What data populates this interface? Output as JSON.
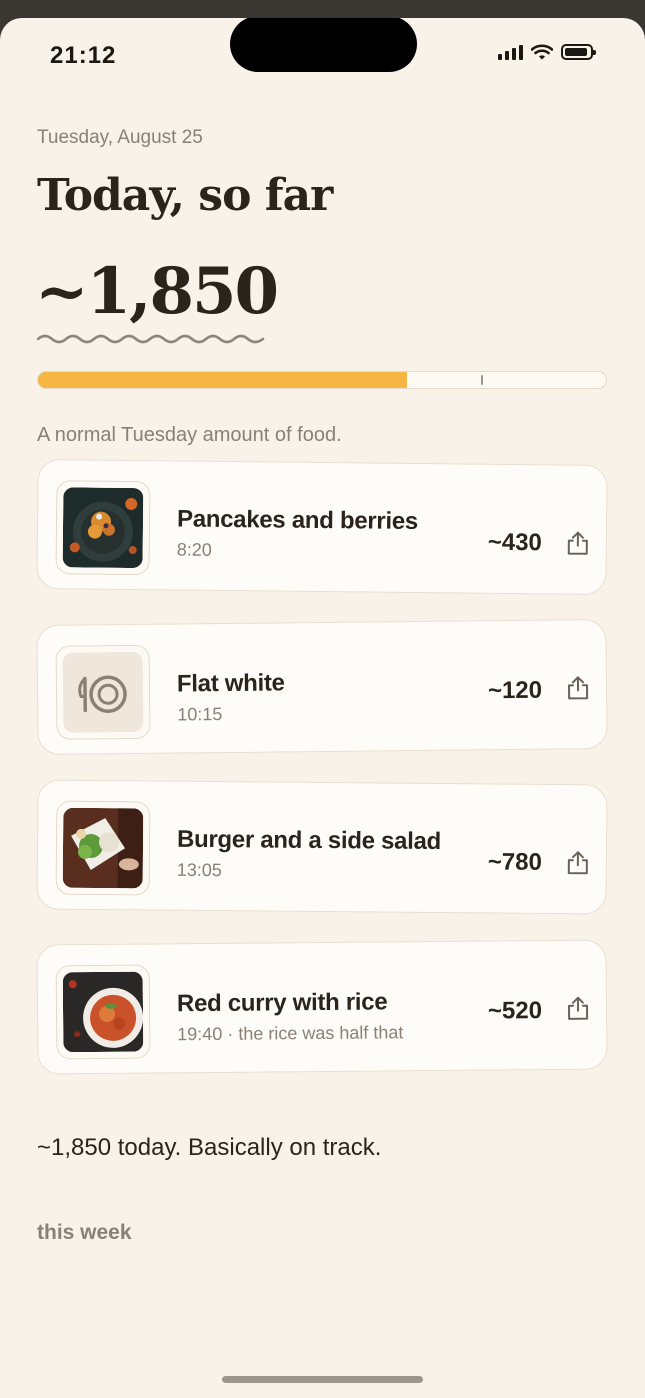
{
  "status_bar": {
    "time": "21:12"
  },
  "header": {
    "date": "Tuesday, August 25",
    "title": "Today, so far",
    "total": "~1,850"
  },
  "progress": {
    "fill_fraction": 0.65,
    "marker_fraction": 0.78,
    "fill_color": "#f5b642"
  },
  "summary": "A normal Tuesday amount of food.",
  "meals": [
    {
      "name": "Pancakes and berries",
      "time": "8:20",
      "calories": "~430",
      "thumb": "pancakes-photo"
    },
    {
      "name": "Flat white",
      "time": "10:15",
      "calories": "~120",
      "thumb": "plate-icon"
    },
    {
      "name": "Burger and a side salad",
      "time": "13:05",
      "calories": "~780",
      "thumb": "burger-photo"
    },
    {
      "name": "Red curry with rice",
      "time": "19:40 · the rice was half that",
      "calories": "~520",
      "thumb": "curry-photo"
    }
  ],
  "footer": {
    "text": "~1,850 today. Basically on track.",
    "week_label": "this week"
  },
  "colors": {
    "background": "#f8f2e8",
    "accent": "#f5b642",
    "muted_text": "#8a8075"
  },
  "icons": [
    "signal-icon",
    "wifi-icon",
    "battery-icon",
    "share-icon",
    "plate-icon"
  ]
}
